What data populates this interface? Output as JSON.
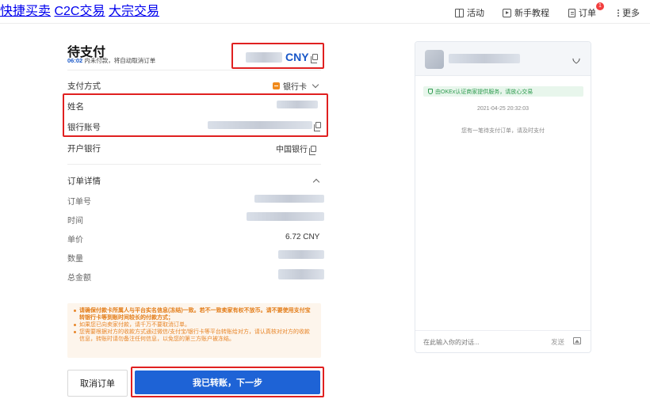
{
  "nav": {
    "left": [
      "快捷买卖",
      "C2C交易",
      "大宗交易"
    ],
    "activity": "活动",
    "tutorial": "新手教程",
    "orders": "订单",
    "orders_badge": "1",
    "more": "更多"
  },
  "order": {
    "title": "待支付",
    "countdown_time": "06:02",
    "countdown_text": "内未付款，将自动取消订单",
    "currency": "CNY"
  },
  "payment": {
    "method_label": "支付方式",
    "method_value": "银行卡",
    "name_label": "姓名",
    "account_label": "银行账号",
    "bank_label": "开户银行",
    "bank_value": "中国银行"
  },
  "details": {
    "header": "订单详情",
    "order_no_label": "订单号",
    "time_label": "时间",
    "price_label": "单价",
    "price_value": "6.72 CNY",
    "qty_label": "数量",
    "total_label": "总金额"
  },
  "notices": [
    "请确保付款卡所属人与平台实名信息(冻结)一致。若不一致卖家有权不放币。请不要使用支付宝转银行卡等到账时间较长的付款方式；",
    "如果您已向卖家付款，请千万不要取消订单。",
    "您需要根据对方的收款方式通过微信/支付宝/银行卡等平台转账给对方，请认真核对对方的收款信息，转账时请勿备注任何信息，以免您的第三方账户被冻结。"
  ],
  "buttons": {
    "cancel": "取消订单",
    "confirm": "我已转账，下一步"
  },
  "chat": {
    "secure_text": "由OKEx认证商家提供服务，请放心交易",
    "timestamp": "2021-04-25 20:32:03",
    "system_msg": "您有一笔待支付订单，请及时支付",
    "input_placeholder": "在此输入你的对话...",
    "send_label": "发送"
  },
  "colors": {
    "accent_blue": "#1e63d6",
    "highlight_red": "#e02020",
    "notice_orange": "#e8862a",
    "secure_green": "#2c9a4d"
  }
}
